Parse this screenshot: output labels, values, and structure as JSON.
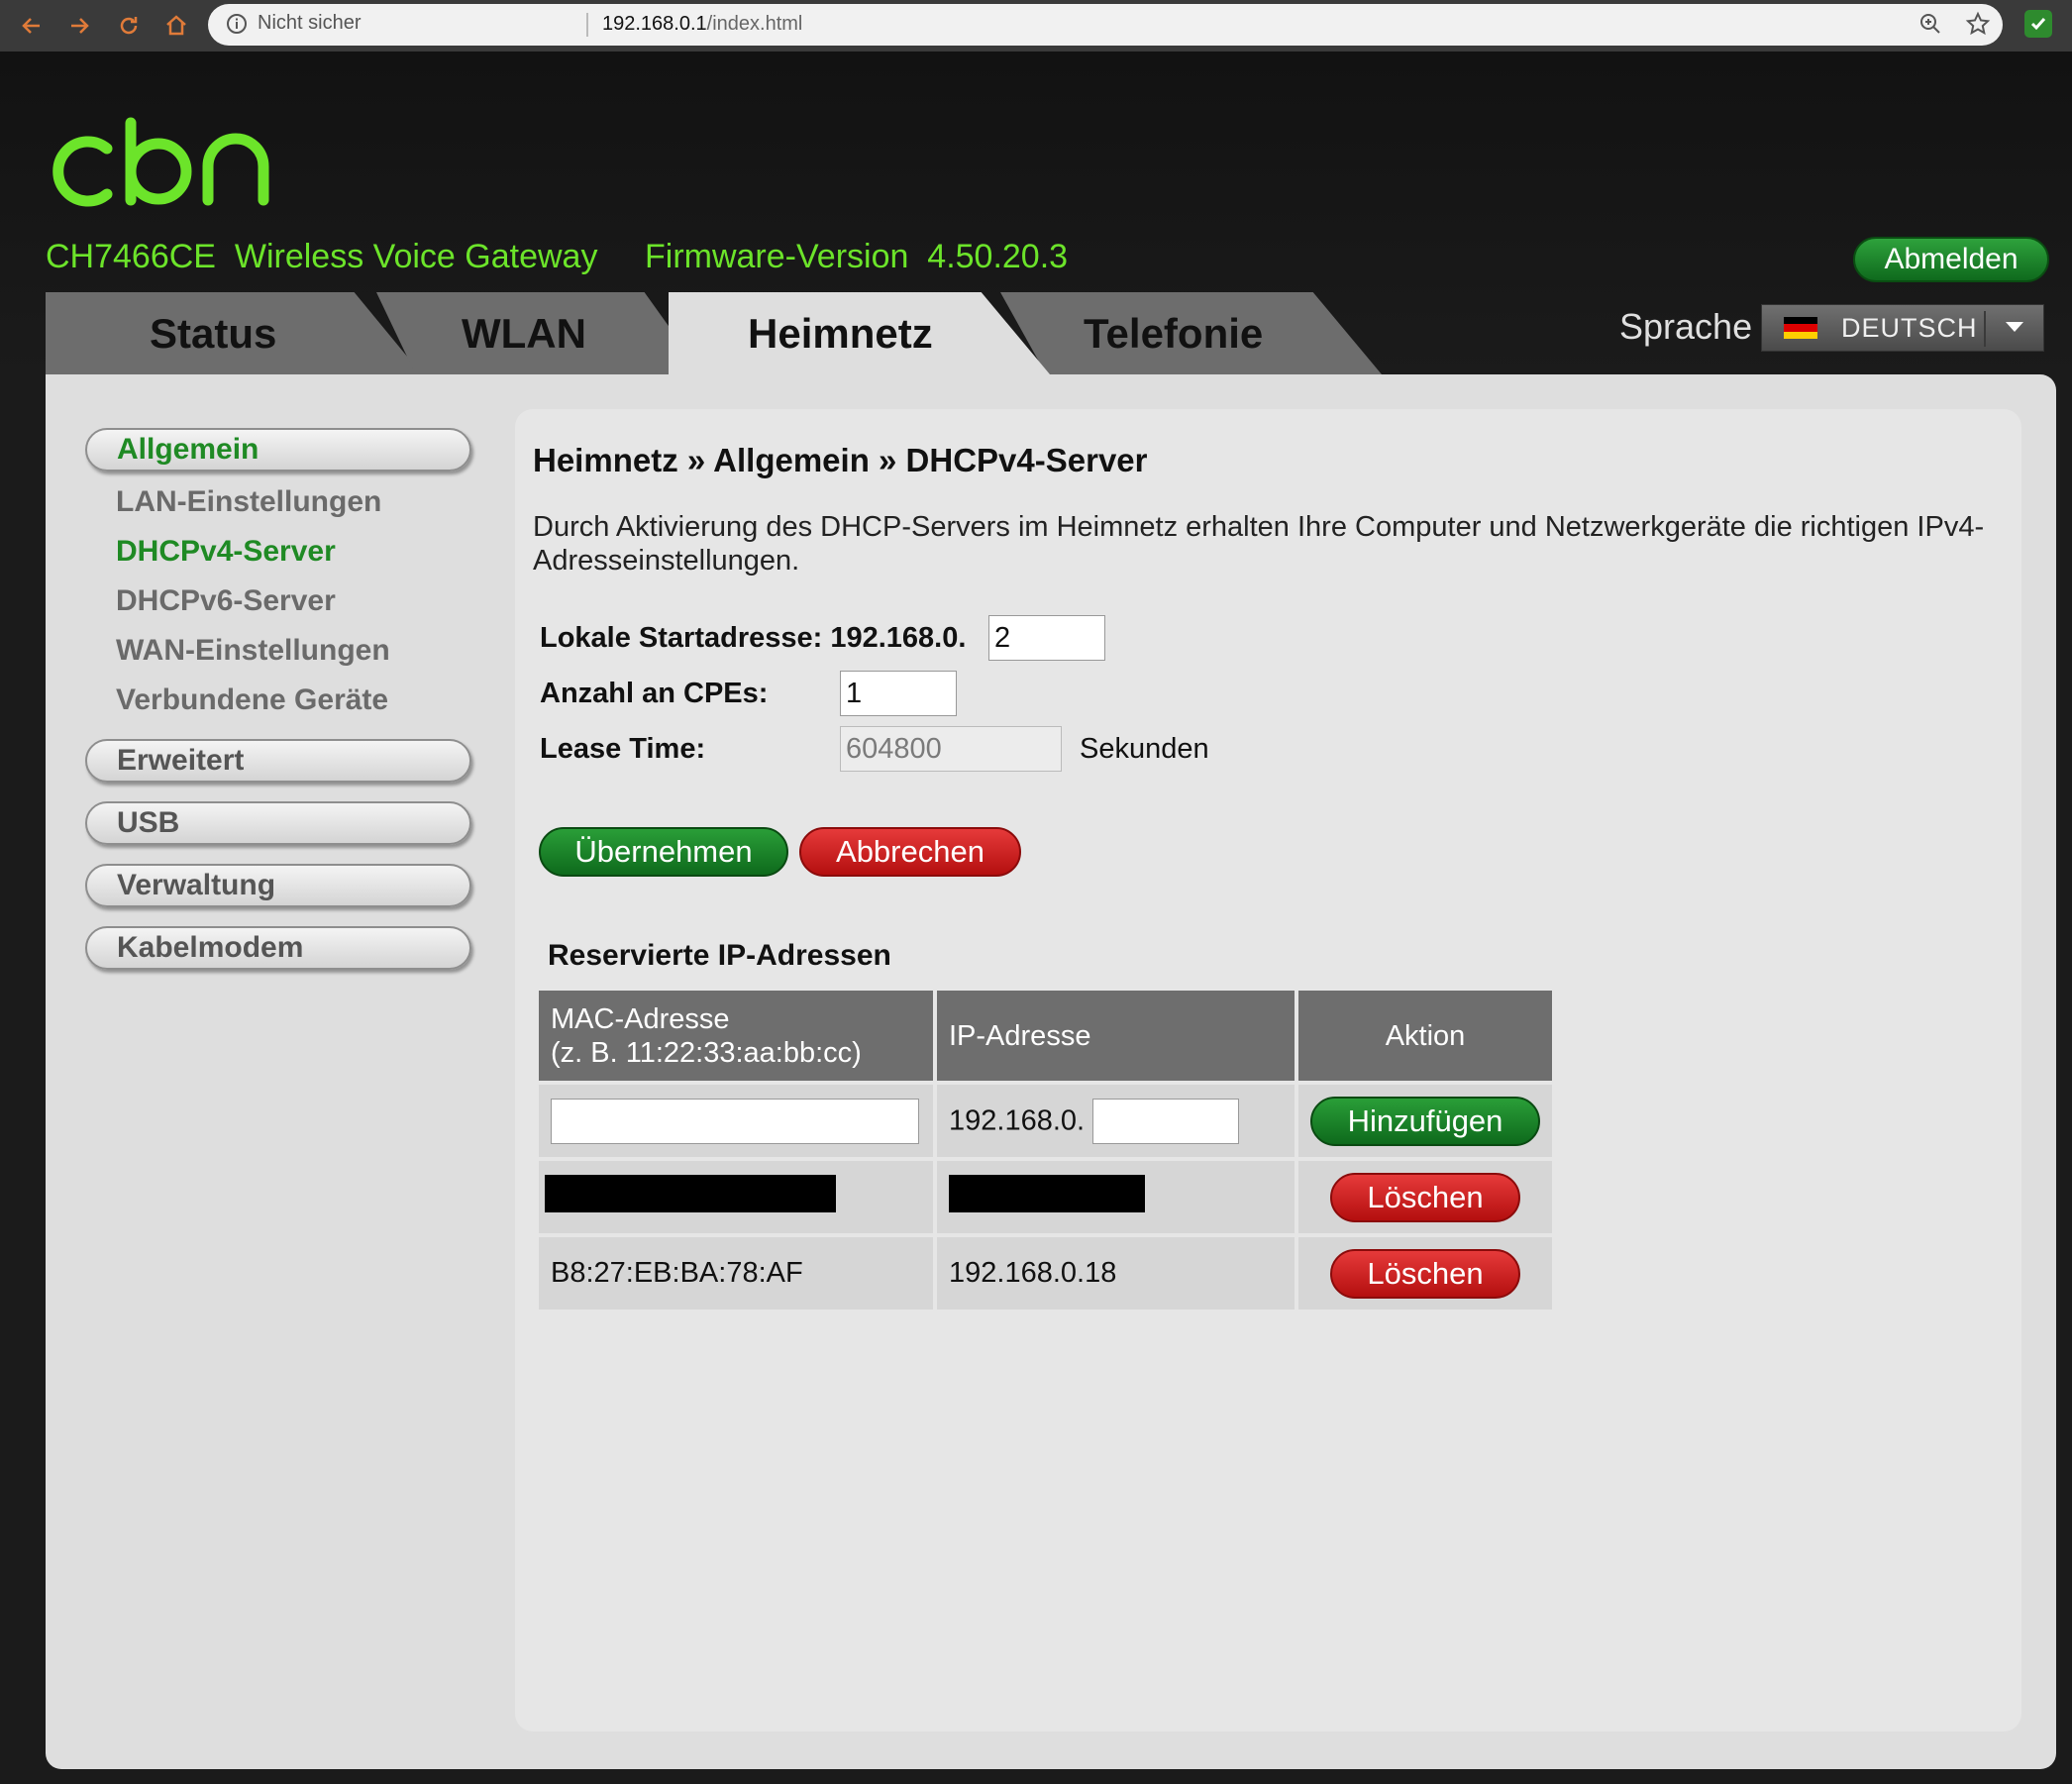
{
  "browser": {
    "security_label": "Nicht sicher",
    "url_host": "192.168.0.1",
    "url_path": "/index.html"
  },
  "header": {
    "model": "CH7466CE  Wireless Voice Gateway",
    "firmware": "Firmware-Version  4.50.20.3",
    "logout_label": "Abmelden",
    "language_label": "Sprache",
    "language_value": "DEUTSCH",
    "logo_color": "#6ce42a"
  },
  "tabs": [
    {
      "label": "Status",
      "active": false
    },
    {
      "label": "WLAN",
      "active": false
    },
    {
      "label": "Heimnetz",
      "active": true
    },
    {
      "label": "Telefonie",
      "active": false
    }
  ],
  "sidebar": {
    "allgemein": "Allgemein",
    "sub": [
      "LAN-Einstellungen",
      "DHCPv4-Server",
      "DHCPv6-Server",
      "WAN-Einstellungen",
      "Verbundene Geräte"
    ],
    "erweitert": "Erweitert",
    "usb": "USB",
    "verwaltung": "Verwaltung",
    "kabelmodem": "Kabelmodem"
  },
  "main": {
    "breadcrumb": "Heimnetz » Allgemein » DHCPv4-Server",
    "description": "Durch Aktivierung des DHCP-Servers im Heimnetz erhalten Ihre Computer und Netzwerkgeräte die richtigen IPv4-Adresseinstellungen.",
    "start_label": "Lokale Startadresse: 192.168.0.",
    "start_value": "2",
    "cpe_label": "Anzahl an CPEs:",
    "cpe_value": "1",
    "lease_label": "Lease Time:",
    "lease_value": "604800",
    "lease_unit": "Sekunden",
    "apply_label": "Übernehmen",
    "cancel_label": "Abbrechen"
  },
  "reserved": {
    "title": "Reservierte IP-Adressen",
    "col_mac": "MAC-Adresse",
    "col_mac_hint": "(z. B. 11:22:33:aa:bb:cc)",
    "col_ip": "IP-Adresse",
    "col_action": "Aktion",
    "ip_prefix": "192.168.0.",
    "add_label": "Hinzufügen",
    "delete_label": "Löschen",
    "rows": [
      {
        "mac": "",
        "ip": ""
      },
      {
        "mac": "B8:27:EB:BA:78:AF",
        "ip": "192.168.0.18"
      }
    ]
  },
  "colors": {
    "accent_green": "#1f8a24",
    "button_green": "#0e6a1c",
    "button_red": "#b40f0f"
  }
}
